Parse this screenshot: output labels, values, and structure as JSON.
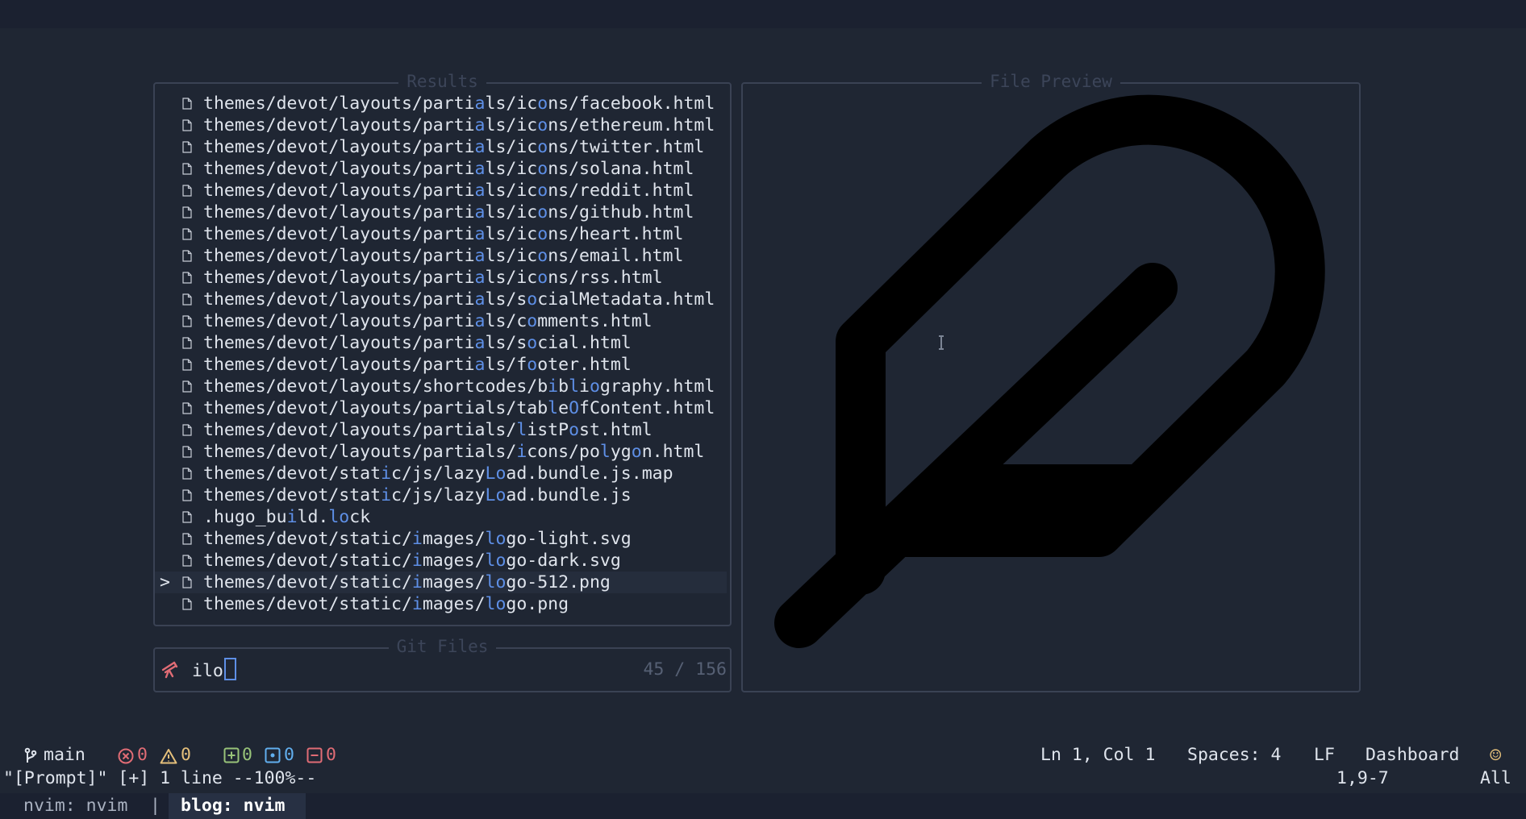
{
  "results_panel": {
    "title": "Results",
    "rows": [
      {
        "segments": [
          [
            "themes/devot/layouts/parti",
            0
          ],
          [
            "a",
            1
          ],
          [
            "ls/ic",
            0
          ],
          [
            "o",
            1
          ],
          [
            "ns/facebook.html",
            0
          ]
        ]
      },
      {
        "segments": [
          [
            "themes/devot/layouts/parti",
            0
          ],
          [
            "a",
            1
          ],
          [
            "ls/ic",
            0
          ],
          [
            "o",
            1
          ],
          [
            "ns/ethereum.html",
            0
          ]
        ]
      },
      {
        "segments": [
          [
            "themes/devot/layouts/parti",
            0
          ],
          [
            "a",
            1
          ],
          [
            "ls/ic",
            0
          ],
          [
            "o",
            1
          ],
          [
            "ns/twitter.html",
            0
          ]
        ]
      },
      {
        "segments": [
          [
            "themes/devot/layouts/parti",
            0
          ],
          [
            "a",
            1
          ],
          [
            "ls/ic",
            0
          ],
          [
            "o",
            1
          ],
          [
            "ns/solana.html",
            0
          ]
        ]
      },
      {
        "segments": [
          [
            "themes/devot/layouts/parti",
            0
          ],
          [
            "a",
            1
          ],
          [
            "ls/ic",
            0
          ],
          [
            "o",
            1
          ],
          [
            "ns/reddit.html",
            0
          ]
        ]
      },
      {
        "segments": [
          [
            "themes/devot/layouts/parti",
            0
          ],
          [
            "a",
            1
          ],
          [
            "ls/ic",
            0
          ],
          [
            "o",
            1
          ],
          [
            "ns/github.html",
            0
          ]
        ]
      },
      {
        "segments": [
          [
            "themes/devot/layouts/parti",
            0
          ],
          [
            "a",
            1
          ],
          [
            "ls/ic",
            0
          ],
          [
            "o",
            1
          ],
          [
            "ns/heart.html",
            0
          ]
        ]
      },
      {
        "segments": [
          [
            "themes/devot/layouts/parti",
            0
          ],
          [
            "a",
            1
          ],
          [
            "ls/ic",
            0
          ],
          [
            "o",
            1
          ],
          [
            "ns/email.html",
            0
          ]
        ]
      },
      {
        "segments": [
          [
            "themes/devot/layouts/parti",
            0
          ],
          [
            "a",
            1
          ],
          [
            "ls/ic",
            0
          ],
          [
            "o",
            1
          ],
          [
            "ns/rss.html",
            0
          ]
        ]
      },
      {
        "segments": [
          [
            "themes/devot/layouts/parti",
            0
          ],
          [
            "a",
            1
          ],
          [
            "ls/s",
            0
          ],
          [
            "o",
            1
          ],
          [
            "cialMetadata.html",
            0
          ]
        ]
      },
      {
        "segments": [
          [
            "themes/devot/layouts/parti",
            0
          ],
          [
            "a",
            1
          ],
          [
            "ls/c",
            0
          ],
          [
            "o",
            1
          ],
          [
            "mments.html",
            0
          ]
        ]
      },
      {
        "segments": [
          [
            "themes/devot/layouts/parti",
            0
          ],
          [
            "a",
            1
          ],
          [
            "ls/s",
            0
          ],
          [
            "o",
            1
          ],
          [
            "cial.html",
            0
          ]
        ]
      },
      {
        "segments": [
          [
            "themes/devot/layouts/parti",
            0
          ],
          [
            "a",
            1
          ],
          [
            "ls/f",
            0
          ],
          [
            "o",
            1
          ],
          [
            "oter.html",
            0
          ]
        ]
      },
      {
        "segments": [
          [
            "themes/devot/layouts/shortcodes/b",
            0
          ],
          [
            "i",
            1
          ],
          [
            "b",
            0
          ],
          [
            "l",
            1
          ],
          [
            "i",
            0
          ],
          [
            "o",
            1
          ],
          [
            "graphy.html",
            0
          ]
        ]
      },
      {
        "segments": [
          [
            "themes/devot/layouts/partials/tab",
            0
          ],
          [
            "l",
            1
          ],
          [
            "e",
            0
          ],
          [
            "O",
            1
          ],
          [
            "fContent.html",
            0
          ]
        ]
      },
      {
        "segments": [
          [
            "themes/devot/layouts/partials/",
            0
          ],
          [
            "l",
            1
          ],
          [
            "istP",
            0
          ],
          [
            "o",
            1
          ],
          [
            "st.html",
            0
          ]
        ]
      },
      {
        "segments": [
          [
            "themes/devot/layouts/partials/",
            0
          ],
          [
            "i",
            1
          ],
          [
            "cons/po",
            0
          ],
          [
            "l",
            1
          ],
          [
            "yg",
            0
          ],
          [
            "o",
            1
          ],
          [
            "n.html",
            0
          ]
        ]
      },
      {
        "segments": [
          [
            "themes/devot/stat",
            0
          ],
          [
            "i",
            1
          ],
          [
            "c/js/lazy",
            0
          ],
          [
            "L",
            1
          ],
          [
            "o",
            1
          ],
          [
            "ad.bundle.js.map",
            0
          ]
        ]
      },
      {
        "segments": [
          [
            "themes/devot/stat",
            0
          ],
          [
            "i",
            1
          ],
          [
            "c/js/lazy",
            0
          ],
          [
            "L",
            1
          ],
          [
            "o",
            1
          ],
          [
            "ad.bundle.js",
            0
          ]
        ]
      },
      {
        "segments": [
          [
            ".hugo_bu",
            0
          ],
          [
            "i",
            1
          ],
          [
            "ld.",
            0
          ],
          [
            "lo",
            1
          ],
          [
            "ck",
            0
          ]
        ]
      },
      {
        "segments": [
          [
            "themes/devot/static/",
            0
          ],
          [
            "i",
            1
          ],
          [
            "mages/",
            0
          ],
          [
            "lo",
            1
          ],
          [
            "go-light.svg",
            0
          ]
        ]
      },
      {
        "segments": [
          [
            "themes/devot/static/",
            0
          ],
          [
            "i",
            1
          ],
          [
            "mages/",
            0
          ],
          [
            "lo",
            1
          ],
          [
            "go-dark.svg",
            0
          ]
        ]
      },
      {
        "segments": [
          [
            "themes/devot/static/",
            0
          ],
          [
            "i",
            1
          ],
          [
            "mages/",
            0
          ],
          [
            "lo",
            1
          ],
          [
            "go-512.png",
            0
          ]
        ],
        "selected": true
      },
      {
        "segments": [
          [
            "themes/devot/static/",
            0
          ],
          [
            "i",
            1
          ],
          [
            "mages/",
            0
          ],
          [
            "lo",
            1
          ],
          [
            "go.png",
            0
          ]
        ]
      }
    ],
    "selection_marker": ">"
  },
  "prompt_panel": {
    "title": "Git Files",
    "icon": "telescope-icon",
    "query": "ilo",
    "count": "45 / 156"
  },
  "preview_panel": {
    "title": "File Preview",
    "image": "feather-logo"
  },
  "statusbar": {
    "branch": "main",
    "errors": "0",
    "warnings": "0",
    "git_added": "0",
    "git_modified": "0",
    "git_removed": "0",
    "position": "Ln 1, Col 1",
    "indent": "Spaces: 4",
    "eol": "LF",
    "mode": "Dashboard",
    "smiley": "☺"
  },
  "cmdline": {
    "message": "\"[Prompt]\" [+] 1 line --100%--",
    "cursor_pos": "1,9-7",
    "scroll": "All"
  },
  "tmux": {
    "window1": "nvim: nvim",
    "separator": "|",
    "window2": "blog: nvim"
  },
  "colors": {
    "background": "#1f2633",
    "match_highlight": "#5e8fe6",
    "border": "#3a4254",
    "error": "#e06c75",
    "warning": "#e5c07b",
    "added": "#98c379",
    "modified": "#61afef",
    "removed": "#e06c75"
  }
}
